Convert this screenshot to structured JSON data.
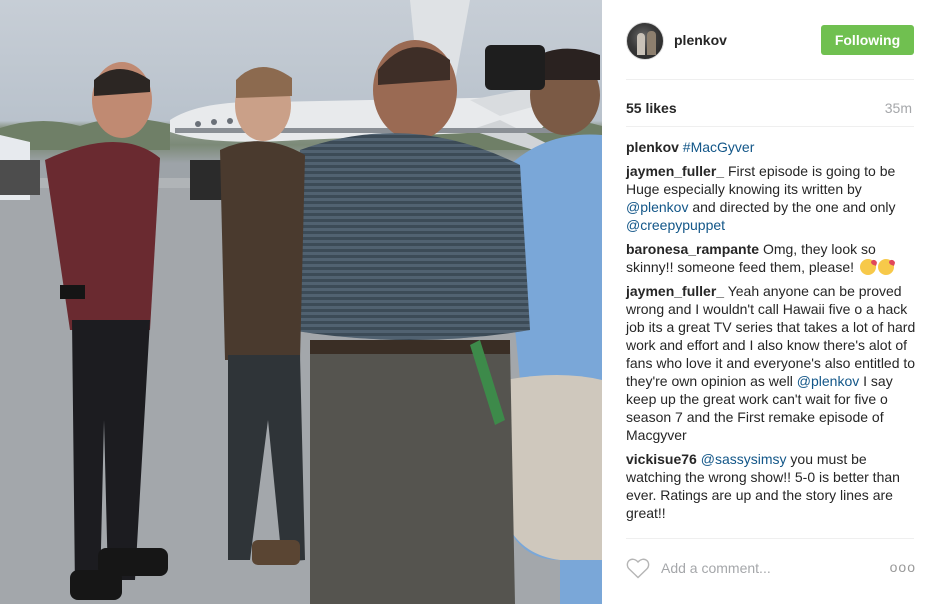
{
  "post": {
    "username": "plenkov",
    "follow_label": "Following",
    "likes": "55 likes",
    "time_ago": "35m"
  },
  "caption": {
    "user": "plenkov",
    "hashtag": "#MacGyver"
  },
  "comments": [
    {
      "user": "jaymen_fuller_",
      "text_1": "First episode is going to be Huge especially knowing its written by",
      "mention_1": "@plenkov",
      "text_2": "and directed by the one and only",
      "mention_2": "@creepypuppet"
    },
    {
      "user": "baronesa_rampante",
      "text_1": "Omg, they look so skinny!! someone feed them, please!"
    },
    {
      "user": "jaymen_fuller_",
      "text_1": "Yeah anyone can be proved wrong and I wouldn't call Hawaii five o a hack job its a great TV series that takes a lot of hard work and effort and I also know there's alot of fans who love it and everyone's also entitled to they're own opinion as well",
      "mention_1": "@plenkov",
      "text_2": "I say keep up the great work can't wait for five o season 7 and the First remake episode of Macgyver"
    },
    {
      "user": "vickisue76",
      "mention_1": "@sassysimsy",
      "text_1": "you must be watching the wrong show!! 5-0 is better than ever. Ratings are up and the story lines are great!!"
    }
  ],
  "comment_box": {
    "placeholder": "Add a comment...",
    "more_label": "ooo"
  },
  "icons": {
    "like": "heart-icon",
    "options": "more-options-icon",
    "emoji": "kissing-face-emoji"
  },
  "colors": {
    "follow_button": "#70c050",
    "link": "#125688",
    "muted": "#a5a7aa"
  }
}
